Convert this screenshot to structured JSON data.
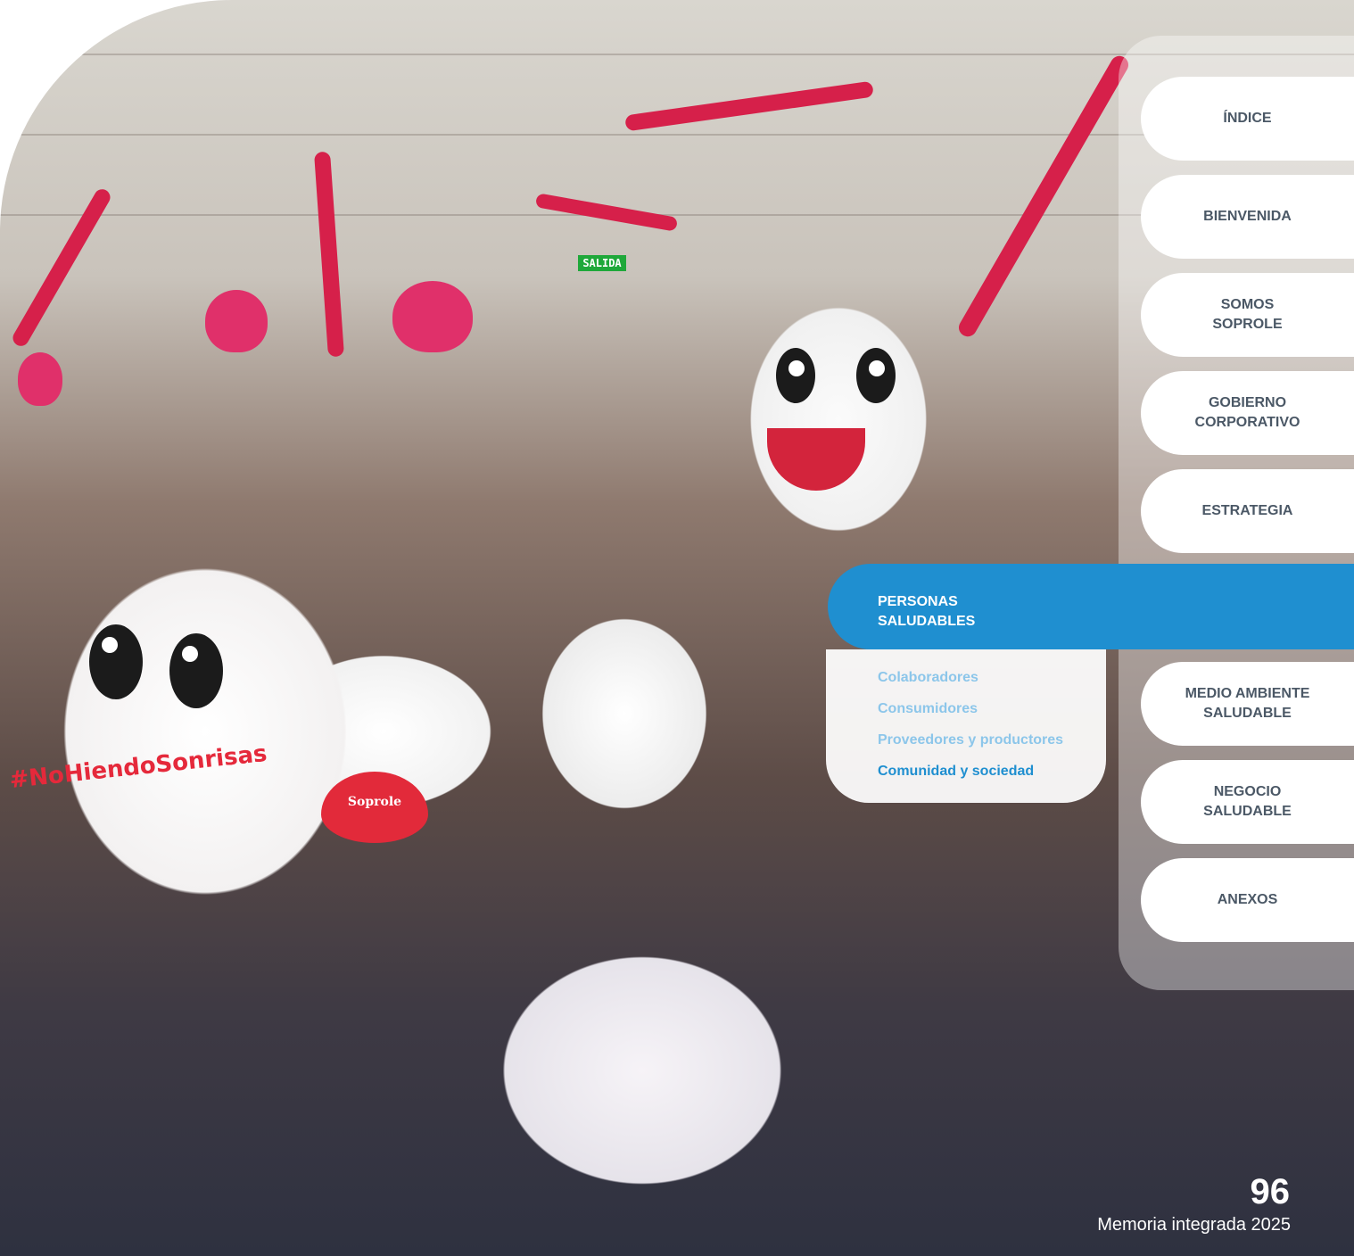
{
  "navigation": {
    "items": [
      {
        "label": "ÍNDICE"
      },
      {
        "label": "BIENVENIDA"
      },
      {
        "label": "SOMOS\nSOPROLE"
      },
      {
        "label": "GOBIERNO\nCORPORATIVO"
      },
      {
        "label": "ESTRATEGIA"
      },
      {
        "label": "MEDIO AMBIENTE\nSALUDABLE"
      },
      {
        "label": "NEGOCIO\nSALUDABLE"
      },
      {
        "label": "ANEXOS"
      }
    ],
    "active_section": {
      "label": "PERSONAS\nSALUDABLES",
      "subsections": [
        {
          "label": "Colaboradores"
        },
        {
          "label": "Consumidores"
        },
        {
          "label": "Proveedores y productores"
        },
        {
          "label": "Comunidad y sociedad"
        }
      ]
    }
  },
  "footer": {
    "page_number": "96",
    "report_title": "Memoria integrada 2025"
  },
  "photo": {
    "description_labels": {
      "exit_sign": "SALIDA",
      "hashtag": "#NoHiendoSonrisas",
      "shirt_logo": "Soprole"
    }
  },
  "colors": {
    "accent": "#1f8fd0",
    "sub_link": "#8cc6ea",
    "nav_text": "#4b5866"
  }
}
